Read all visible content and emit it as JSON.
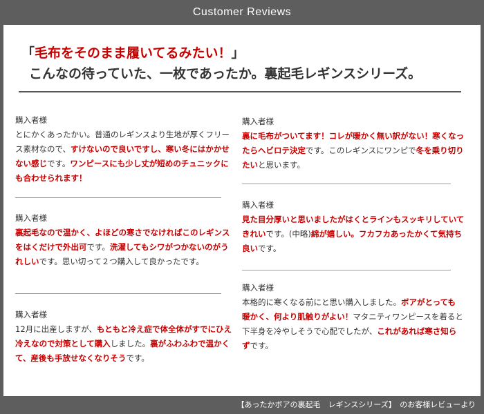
{
  "header": {
    "title": "Customer Reviews"
  },
  "headline": {
    "open_bracket": "「",
    "quote": "毛布をそのまま履いてるみたい！",
    "close_bracket": "」",
    "line2": "こんなの待っていた、一枚であったか。裏起毛レギンスシリーズ。"
  },
  "reviews_left": [
    {
      "by": "購入者様",
      "segments": [
        {
          "t": "とにかくあったかい。普通のレギンスより生地が厚くフリース素材なので、",
          "hl": false
        },
        {
          "t": "すけないので良いですし、寒い冬にはかかせない感じ",
          "hl": true
        },
        {
          "t": "です。",
          "hl": false
        },
        {
          "t": "ワンピースにも少し丈が短めのチュニックにも合わせられます！",
          "hl": true
        }
      ]
    },
    {
      "by": "購入者様",
      "segments": [
        {
          "t": "裏起毛なので温かく、よほどの寒さでなければこのレギンスをはくだけで外出可",
          "hl": true
        },
        {
          "t": "です。",
          "hl": false
        },
        {
          "t": "洗濯してもシワがつかないのがうれしい",
          "hl": true
        },
        {
          "t": "です。思い切って２つ購入して良かったです。",
          "hl": false
        }
      ]
    },
    {
      "by": "購入者様",
      "segments": [
        {
          "t": "12月に出産しますが、",
          "hl": false
        },
        {
          "t": "もともと冷え症で体全体がすでにひえ冷えなので対策として購入",
          "hl": true
        },
        {
          "t": "しました。",
          "hl": false
        },
        {
          "t": "裏がふわふわで温かくて、産後も手放せなくなりそう",
          "hl": true
        },
        {
          "t": "です。",
          "hl": false
        }
      ]
    }
  ],
  "reviews_right": [
    {
      "by": "購入者様",
      "segments": [
        {
          "t": "裏に毛布がついてます！コレが暖かく無い訳がない！寒くなったらヘビロテ決定",
          "hl": true
        },
        {
          "t": "です。このレギンスにワンピで",
          "hl": false
        },
        {
          "t": "冬を乗り切りたい",
          "hl": true
        },
        {
          "t": "と思います。",
          "hl": false
        }
      ]
    },
    {
      "by": "購入者様",
      "segments": [
        {
          "t": "見た目分厚いと思いましたがはくとラインもスッキリしていてきれい",
          "hl": true
        },
        {
          "t": "です。(中略)",
          "hl": false
        },
        {
          "t": "綿が嬉しい。フカフカあったかくて気持ち良い",
          "hl": true
        },
        {
          "t": "です。",
          "hl": false
        }
      ]
    },
    {
      "by": "購入者様",
      "segments": [
        {
          "t": "本格的に寒くなる前にと思い購入しました。",
          "hl": false
        },
        {
          "t": "ボアがとっても暖かく、何より肌触りがよい！",
          "hl": true
        },
        {
          "t": "マタニティワンピースを着ると下半身を冷やしそうで心配でしたが、",
          "hl": false
        },
        {
          "t": "これがあれば寒さ知らず",
          "hl": true
        },
        {
          "t": "です。",
          "hl": false
        }
      ]
    }
  ],
  "footer": {
    "text": "【あったかボアの裏起毛　レギンスシリーズ】　のお客様レビューより"
  },
  "colors": {
    "frame": "#5e5e5e",
    "highlight": "#c80000"
  }
}
